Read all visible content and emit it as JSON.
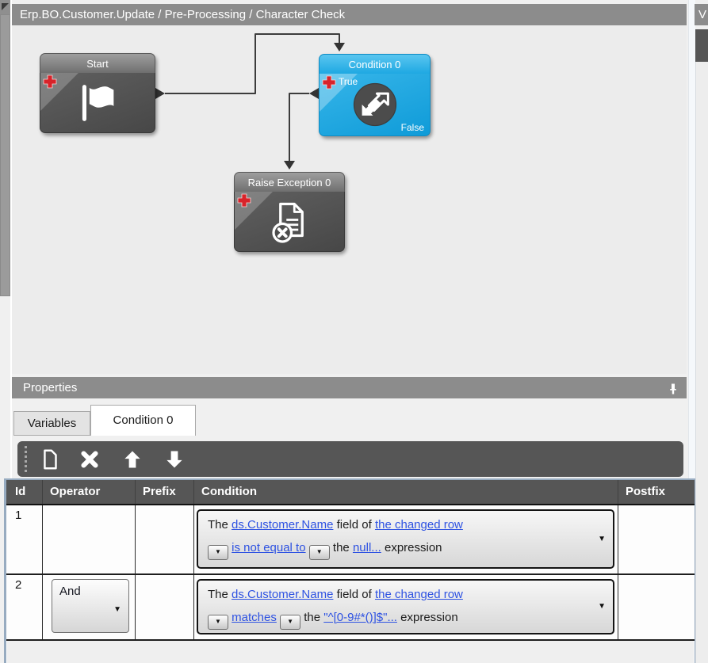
{
  "window": {
    "canvas_title": "Erp.BO.Customer.Update / Pre-Processing / Character Check",
    "right_panel_title": "V"
  },
  "workflow": {
    "start": {
      "title": "Start"
    },
    "condition": {
      "title": "Condition 0",
      "true_label": "True",
      "false_label": "False"
    },
    "raise_exception": {
      "title": "Raise Exception 0"
    }
  },
  "properties": {
    "title": "Properties",
    "tabs": [
      "Variables",
      "Condition 0"
    ]
  },
  "grid": {
    "headers": [
      "Id",
      "Operator",
      "Prefix",
      "Condition",
      "Postfix"
    ],
    "rows": [
      {
        "id": "1",
        "operator": "",
        "prefix": "",
        "postfix": "",
        "condition": {
          "t_the": "The",
          "field_link": "ds.Customer.Name",
          "t_field_of": "field of",
          "row_link": "the changed row",
          "operator_link": "is not equal to",
          "t_the2": "the",
          "value_link": "null...",
          "t_expression": "expression"
        }
      },
      {
        "id": "2",
        "operator": "And",
        "prefix": "",
        "postfix": "",
        "condition": {
          "t_the": "The",
          "field_link": "ds.Customer.Name",
          "t_field_of": "field of",
          "row_link": "the changed row",
          "operator_link": "matches",
          "t_the2": "the",
          "value_link": "\"^[0-9#*()]$\"...",
          "t_expression": "expression"
        }
      }
    ]
  },
  "icons": {
    "caret_down": "▼"
  },
  "colors": {
    "accent_blue": "#1EA8E2",
    "node_gray": "#4F4F4F",
    "header_gray": "#8C8C8C",
    "toolbar_dark": "#565656",
    "plus_red": "#D8232A",
    "link_blue": "#2E52E2",
    "grid_border_steel": "#97ABC0"
  }
}
